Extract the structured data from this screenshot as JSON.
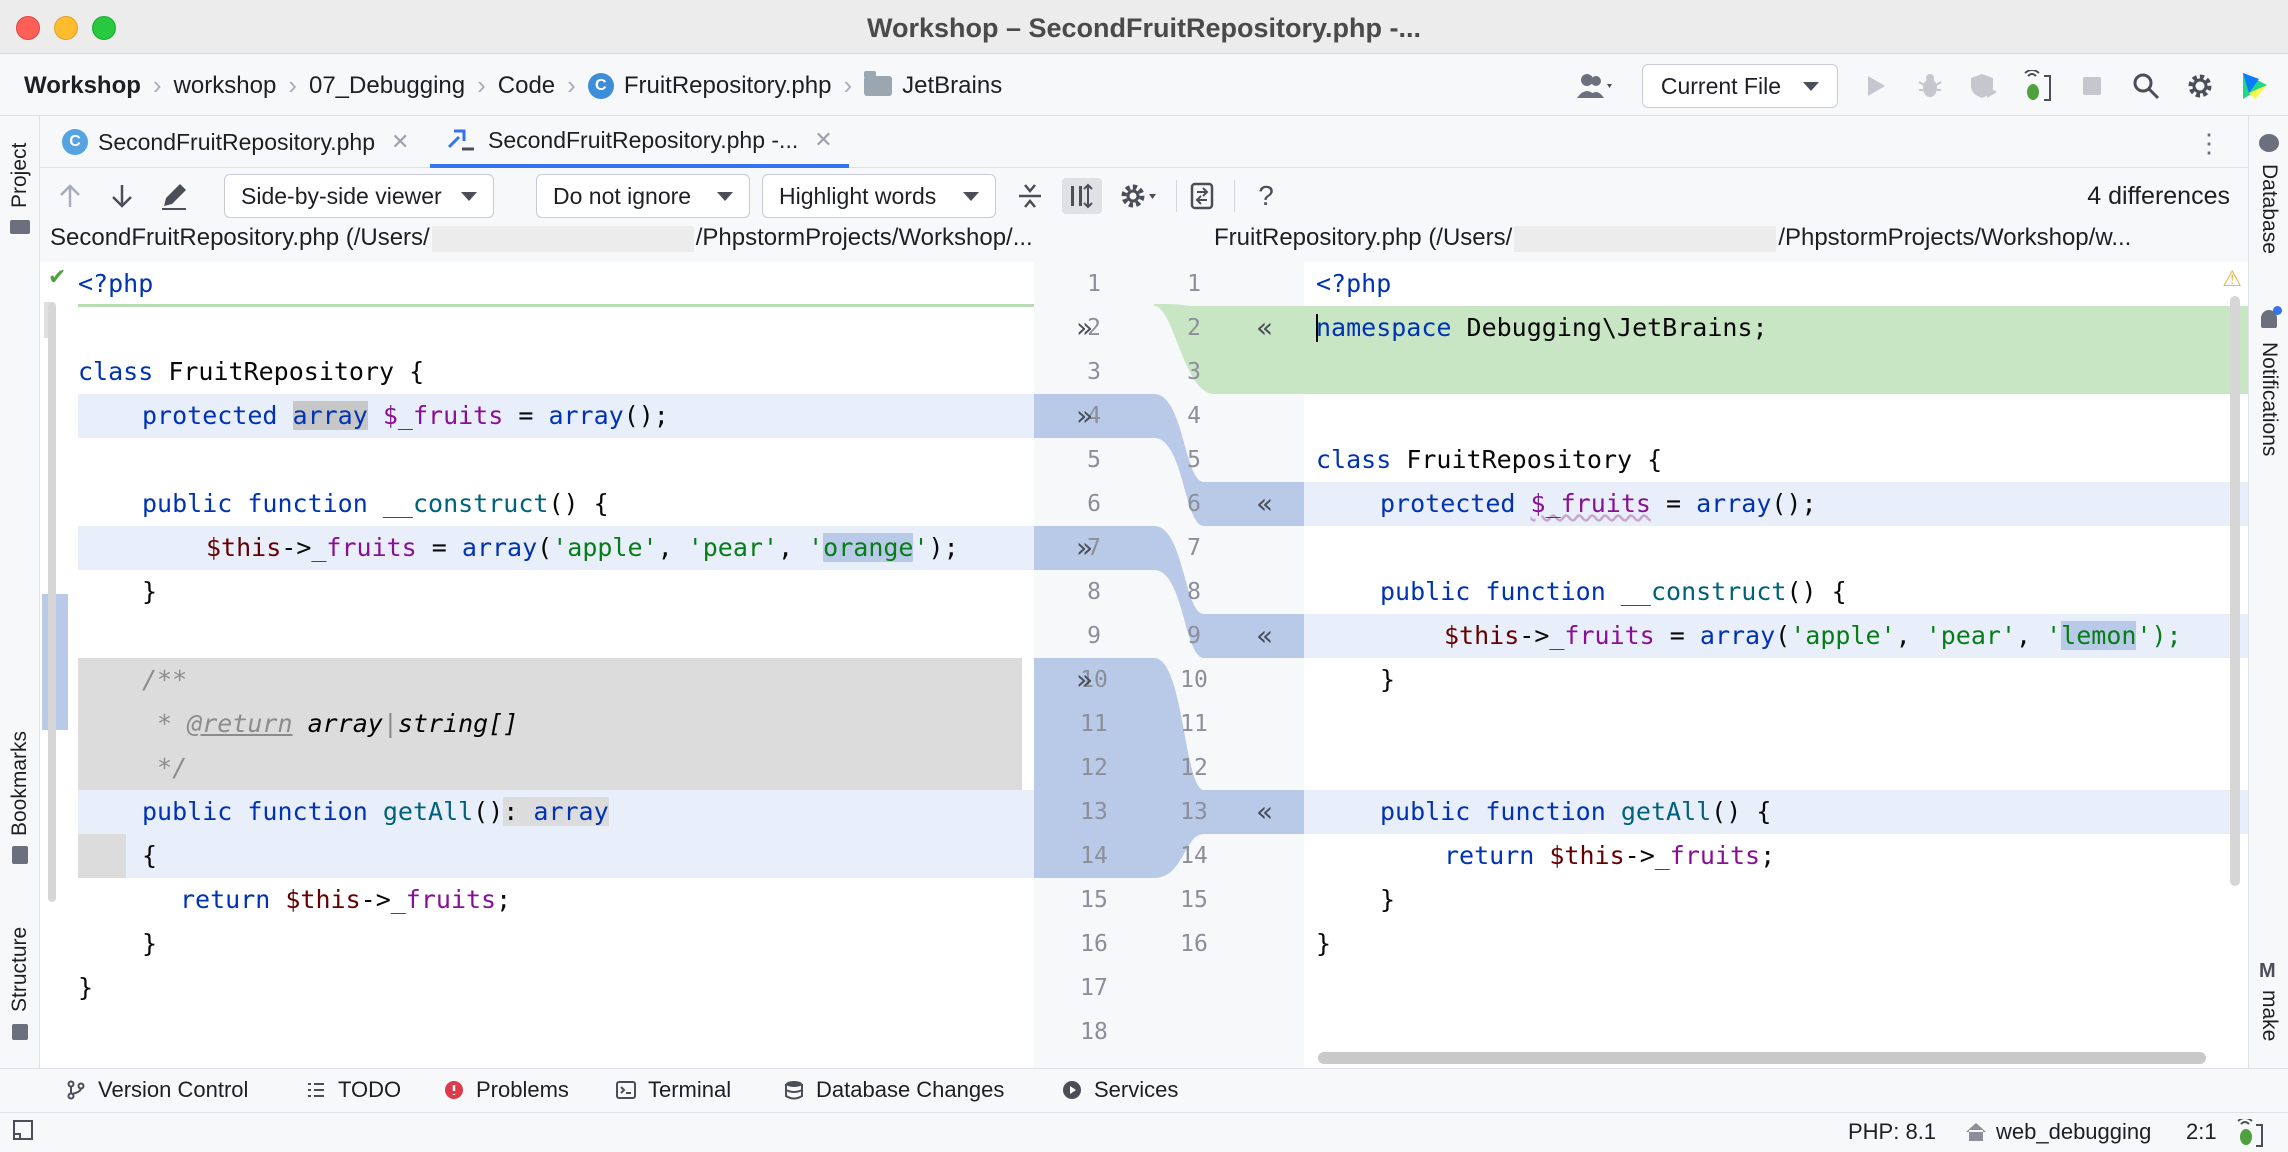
{
  "window": {
    "title": "Workshop – SecondFruitRepository.php -..."
  },
  "breadcrumbs": [
    "Workshop",
    "workshop",
    "07_Debugging",
    "Code",
    "FruitRepository.php",
    "JetBrains"
  ],
  "run_config": {
    "label": "Current File"
  },
  "tabs": [
    {
      "label": "SecondFruitRepository.php",
      "icon": "php-class-icon"
    },
    {
      "label": "SecondFruitRepository.php -...",
      "icon": "diff-icon",
      "active": true
    }
  ],
  "diff_toolbar": {
    "viewer": "Side-by-side viewer",
    "ignore": "Do not ignore",
    "highlight": "Highlight words",
    "help": "?",
    "count": "4 differences"
  },
  "left_path": {
    "prefix": "SecondFruitRepository.php (/Users/",
    "suffix": "/PhpstormProjects/Workshop/..."
  },
  "right_path": {
    "prefix": "FruitRepository.php (/Users/",
    "suffix": "/PhpstormProjects/Workshop/w..."
  },
  "left_gutter_numbers": [
    "1",
    "2",
    "3",
    "4",
    "5",
    "6",
    "7",
    "8",
    "9",
    "10",
    "11",
    "12",
    "13",
    "14",
    "15",
    "16",
    "17",
    "18"
  ],
  "right_gutter_numbers": [
    "1",
    "2",
    "3",
    "4",
    "5",
    "6",
    "7",
    "8",
    "9",
    "10",
    "11",
    "12",
    "13",
    "14",
    "15",
    "16"
  ],
  "left_code": {
    "l1": "<?php",
    "l3a": "class",
    "l3b": " FruitRepository {",
    "l4a": "protected",
    "l4b": "array",
    "l4c": "$_fruits",
    "l4d": " = ",
    "l4e": "array",
    "l4f": "();",
    "l6a": "public",
    "l6b": "function",
    "l6c": "__construct",
    "l6d": "() {",
    "l7a": "$this",
    "l7b": "->",
    "l7c": "_fruits",
    "l7d": " = ",
    "l7e": "array",
    "l7f": "(",
    "l7g": "'apple'",
    "l7h": ", ",
    "l7i": "'pear'",
    "l7j": ", ",
    "l7k": "'",
    "l7l": "orange",
    "l7m": "'",
    "l7n": ");",
    "l8": "}",
    "l10": "/**",
    "l11a": " * ",
    "l11b": "@return",
    "l11c": " array",
    "l11d": "|",
    "l11e": "string[]",
    "l12": " */",
    "l13a": "public",
    "l13b": "function",
    "l13c": "getAll",
    "l13d": "()",
    "l13e": ": ",
    "l13f": "array",
    "l14": "{",
    "l15a": "return",
    "l15b": "$this",
    "l15c": "->",
    "l15d": "_fruits",
    "l15e": ";",
    "l16": "}",
    "l17": "}"
  },
  "right_code": {
    "l1": "<?php",
    "l2a": "namespace",
    "l2b": " Debugging\\JetBrains;",
    "l5a": "class",
    "l5b": " FruitRepository {",
    "l6a": "protected",
    "l6b": "$_fruits",
    "l6c": " = ",
    "l6d": "array",
    "l6e": "();",
    "l8a": "public",
    "l8b": "function",
    "l8c": "__construct",
    "l8d": "() {",
    "l9a": "$this",
    "l9b": "->",
    "l9c": "_fruits",
    "l9d": " = ",
    "l9e": "array",
    "l9f": "(",
    "l9g": "'apple'",
    "l9h": ", ",
    "l9i": "'pear'",
    "l9j": ", ",
    "l9k": "'",
    "l9l": "lemon",
    "l9m": "');",
    "l10": "}",
    "l12a": "public",
    "l12b": "function",
    "l12c": "getAll",
    "l12d": "() {",
    "l13a": "return",
    "l13b": "$this",
    "l13c": "->",
    "l13d": "_fruits",
    "l13e": ";",
    "l14": "}",
    "l15": "}"
  },
  "left_strip": {
    "project": "Project",
    "bookmarks": "Bookmarks",
    "structure": "Structure"
  },
  "right_strip": {
    "database": "Database",
    "notifications": "Notifications",
    "make": "make",
    "make_icon": "M"
  },
  "bottom_tools": [
    "Version Control",
    "TODO",
    "Problems",
    "Terminal",
    "Database Changes",
    "Services"
  ],
  "status": {
    "php": "PHP: 8.1",
    "server": "web_debugging",
    "position": "2:1"
  },
  "colors": {
    "accent": "#3574f0",
    "changed": "#e8eefa",
    "inserted": "#c8e6c4",
    "deleted": "#dcdcdc"
  }
}
